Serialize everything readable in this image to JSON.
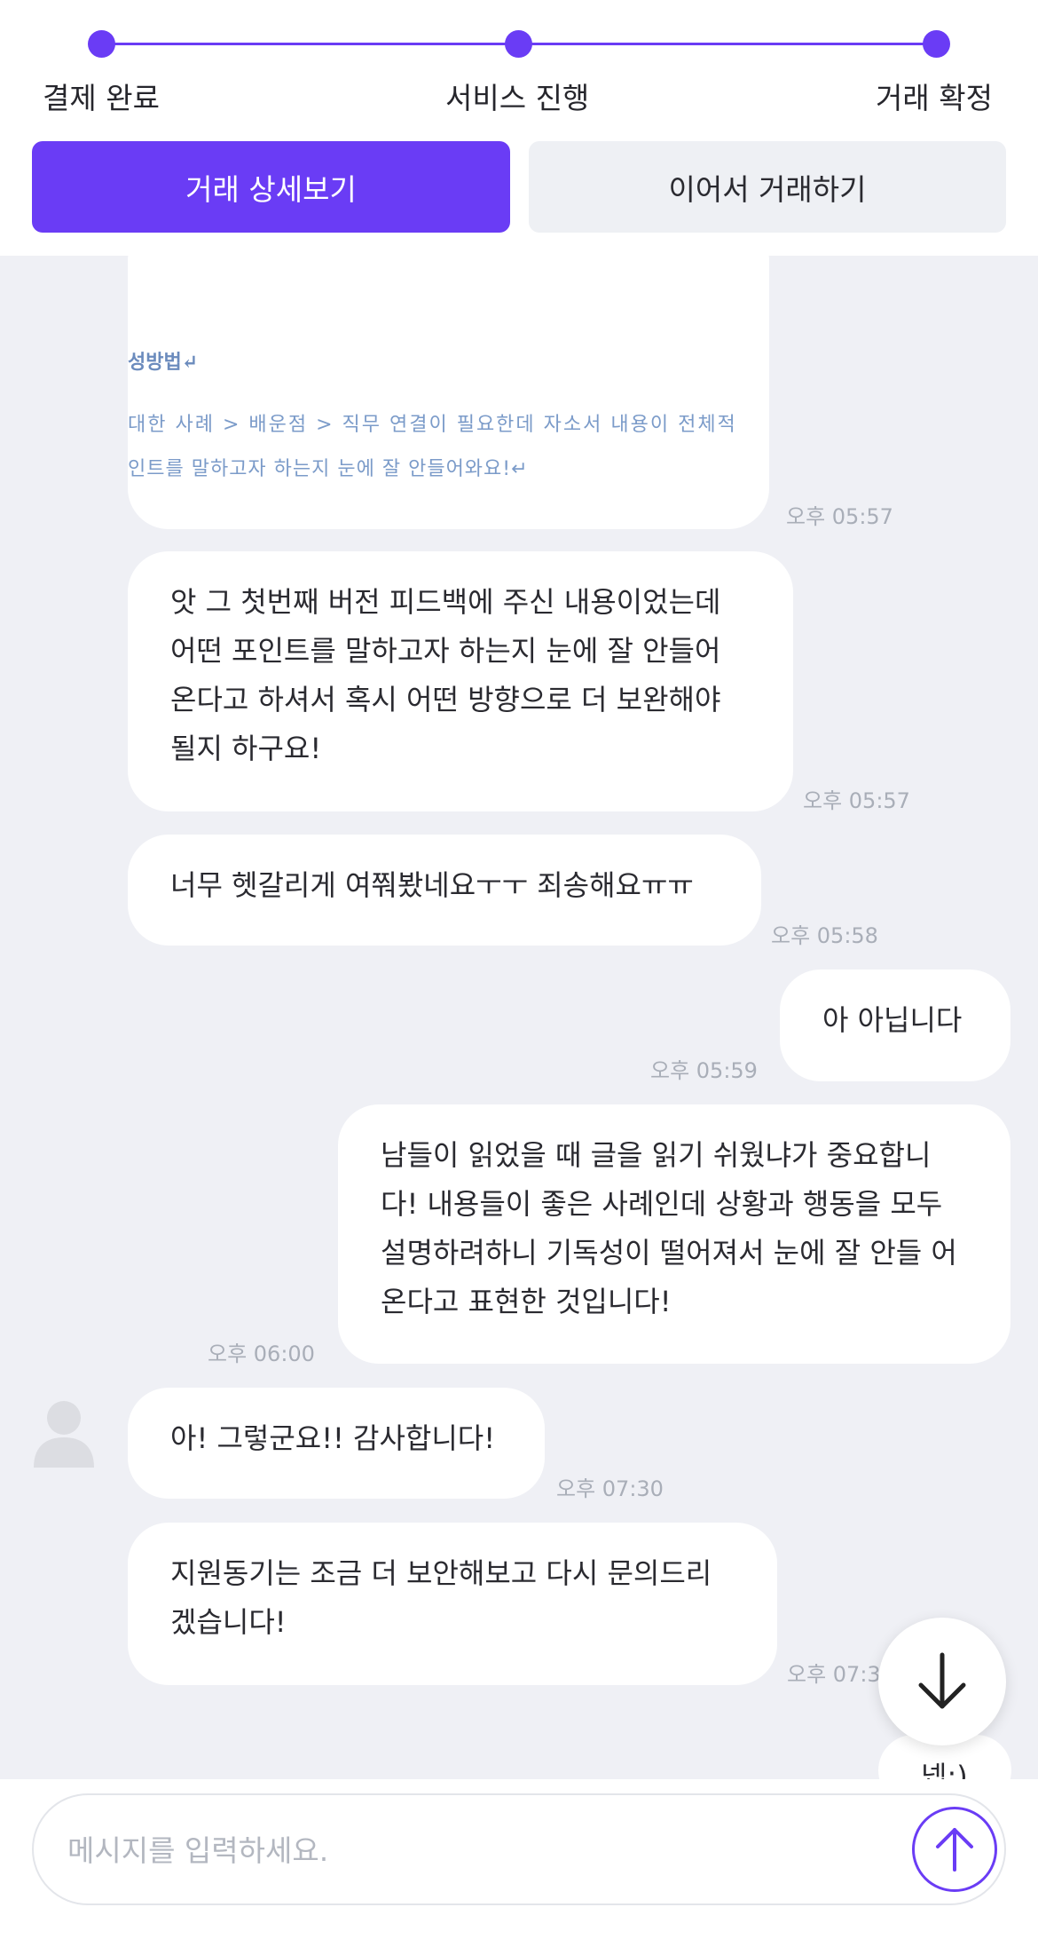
{
  "progress": {
    "steps": [
      "결제 완료",
      "서비스 진행",
      "거래 확정"
    ]
  },
  "actions": {
    "detail_label": "거래 상세보기",
    "continue_label": "이어서 거래하기"
  },
  "document_preview": {
    "heading": "성방법↵",
    "line1": "대한 사례 > 배운점 > 직무 연결이 필요한데 자소서 내용이 전체적",
    "line2": "인트를 말하고자 하는지 눈에 잘 안들어와요!↵",
    "time": "오후 05:57"
  },
  "messages": [
    {
      "sender": "other",
      "text": "앗 그 첫번째 버전 피드백에 주신 내용이었는데 어떤 포인트를 말하고자 하는지 눈에 잘 안들어 온다고 하셔서 혹시 어떤 방향으로 더 보완해야 될지 하구요!",
      "time": "오후 05:57"
    },
    {
      "sender": "other",
      "text": "너무 헷갈리게 여쭤봤네요ㅜㅜ 죄송해요ㅠㅠ",
      "time": "오후 05:58"
    },
    {
      "sender": "me",
      "text": "아 아닙니다",
      "time": "오후 05:59"
    },
    {
      "sender": "me",
      "text": "남들이 읽었을 때 글을 읽기 쉬웠냐가 중요합니다! 내용들이 좋은 사례인데 상황과 행동을 모두 설명하려하니 기독성이 떨어져서 눈에 잘 안들 어온다고 표현한 것입니다!",
      "time": "오후 06:00"
    },
    {
      "sender": "other",
      "text": "아! 그렇군요!! 감사합니다!",
      "time": "오후 07:30"
    },
    {
      "sender": "other",
      "text": "지원동기는 조금 더 보안해보고 다시 문의드리 겠습니다!",
      "time": "오후 07:3"
    },
    {
      "sender": "me",
      "text": "넵:)",
      "time": ""
    }
  ],
  "input": {
    "placeholder": "메시지를 입력하세요."
  },
  "colors": {
    "accent": "#6a3cf5",
    "chat_bg": "#eff0f5",
    "bubble": "#ffffff",
    "time": "#a9aeb8"
  },
  "icons": {
    "scroll_down": "arrow-down-icon",
    "send": "arrow-up-icon",
    "avatar": "user-avatar-icon"
  }
}
